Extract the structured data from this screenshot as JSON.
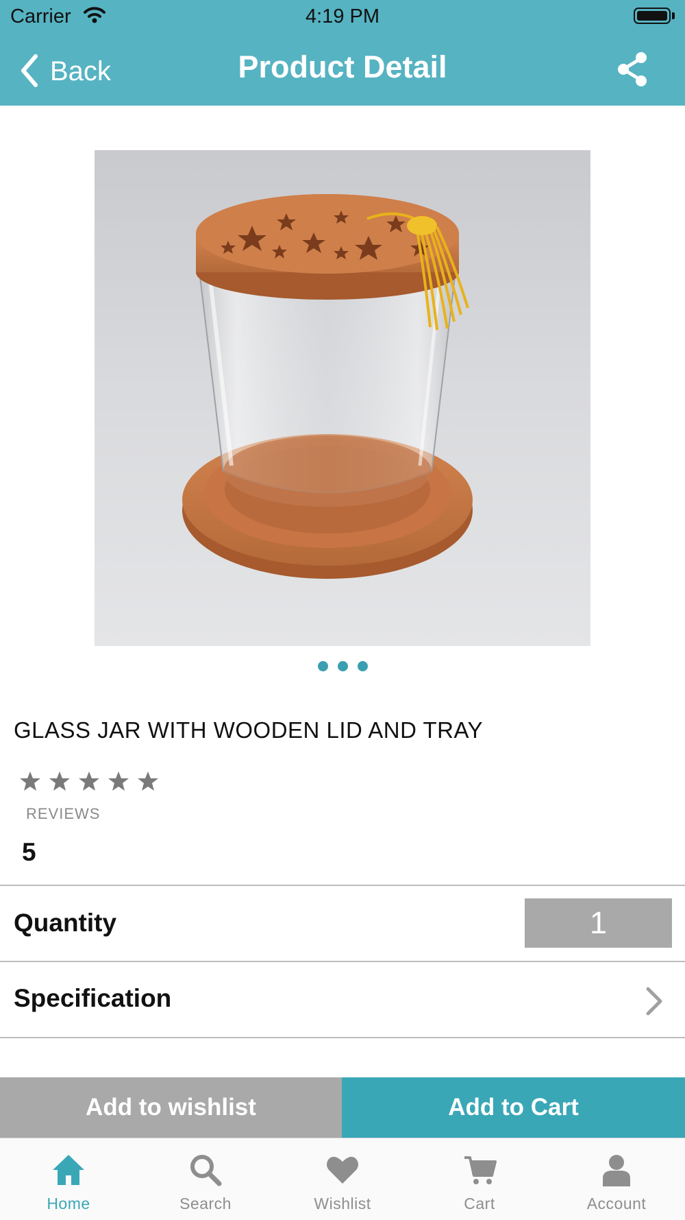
{
  "status_bar": {
    "carrier": "Carrier",
    "time": "4:19 PM"
  },
  "nav": {
    "back_label": "Back",
    "title": "Product Detail"
  },
  "carousel": {
    "page_count": 3,
    "current_page": 1
  },
  "product": {
    "title": "GLASS JAR WITH WOODEN LID AND TRAY",
    "rating_stars": 5,
    "reviews_label": "REVIEWS",
    "reviews_count": "5"
  },
  "quantity": {
    "label": "Quantity",
    "value": "1"
  },
  "specification": {
    "label": "Specification"
  },
  "actions": {
    "wishlist_label": "Add to wishlist",
    "cart_label": "Add to Cart"
  },
  "tabs": [
    {
      "label": "Home",
      "icon": "home-icon",
      "active": true
    },
    {
      "label": "Search",
      "icon": "search-icon",
      "active": false
    },
    {
      "label": "Wishlist",
      "icon": "heart-icon",
      "active": false
    },
    {
      "label": "Cart",
      "icon": "cart-icon",
      "active": false
    },
    {
      "label": "Account",
      "icon": "account-icon",
      "active": false
    }
  ],
  "colors": {
    "header": "#56b3c2",
    "accent": "#3aa7b7",
    "secondary_button": "#a9a9a9",
    "inactive_tab": "#8e8e8e"
  }
}
